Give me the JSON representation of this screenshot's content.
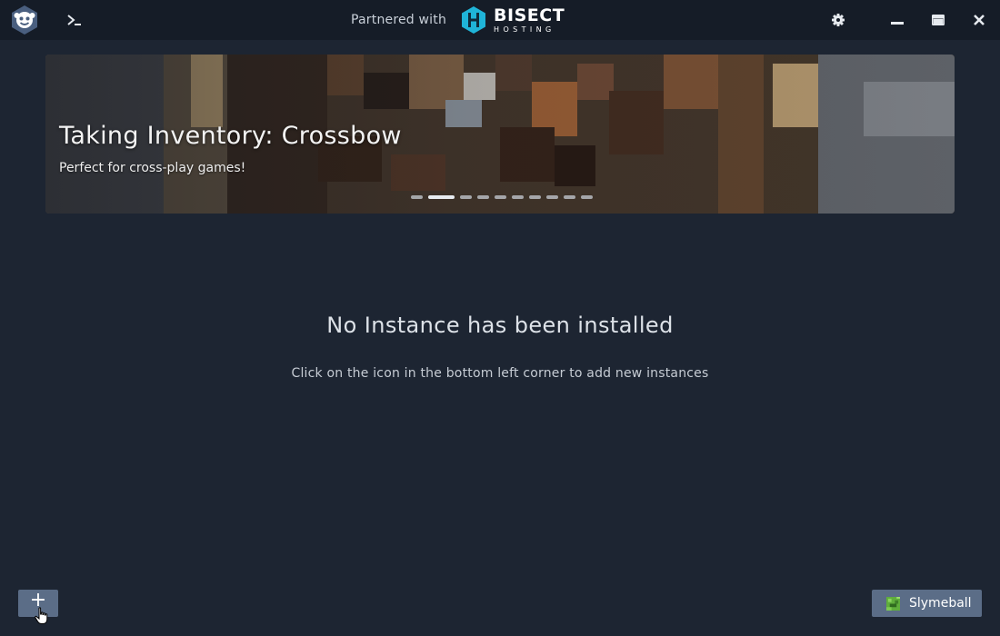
{
  "titlebar": {
    "logo_icon": "monkey-shield-logo-icon",
    "console_icon": "terminal-icon",
    "partner_text": "Partnered with",
    "partner_logo": {
      "name": "BISECT",
      "sub": "HOSTING"
    },
    "settings_icon": "gear-icon",
    "minimize_icon": "minimize-icon",
    "maximize_icon": "maximize-icon",
    "close_icon": "close-icon"
  },
  "banner": {
    "title": "Taking Inventory: Crossbow",
    "subtitle": "Perfect for cross-play games!",
    "slide_count": 10,
    "active_slide": 2
  },
  "empty_state": {
    "title": "No Instance has been installed",
    "message": "Click on the icon in the bottom left corner to add new instances"
  },
  "footer": {
    "add_label": "+",
    "account_name": "Slymeball",
    "account_icon": "player-skin-avatar-icon"
  },
  "colors": {
    "background": "#1d2532",
    "titlebar": "#151c27",
    "button": "#5b6d87",
    "bisect_accent": "#1fb4d8"
  }
}
